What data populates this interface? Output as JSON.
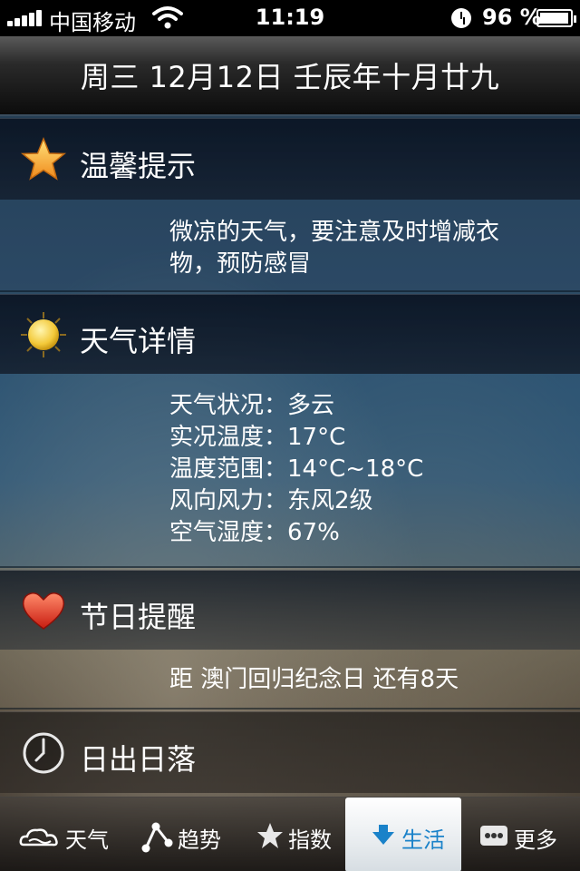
{
  "status": {
    "carrier": "中国移动",
    "time": "11:19",
    "battery": "96 %"
  },
  "header": {
    "date": "周三 12月12日 壬辰年十月廿九"
  },
  "sections": {
    "tips": {
      "icon": "star-icon",
      "title": "温馨提示",
      "lines": [
        "微凉的天气，要注意及时增减衣",
        "物，预防感冒"
      ]
    },
    "weather": {
      "icon": "sun-icon",
      "title": "天气详情",
      "lines": [
        "天气状况：多云",
        "实况温度：17°C",
        "温度范围：14°C~18°C",
        "风向风力：东风2级",
        "空气湿度：67%"
      ]
    },
    "festival": {
      "icon": "heart-icon",
      "title": "节日提醒",
      "line": "距 澳门回归纪念日 还有8天"
    },
    "sunrise": {
      "icon": "clock-icon",
      "title": "日出日落"
    }
  },
  "tabs": [
    {
      "label": "天气",
      "icon": "cloud-icon",
      "active": false
    },
    {
      "label": "趋势",
      "icon": "trend-icon",
      "active": false
    },
    {
      "label": "指数",
      "icon": "index-icon",
      "active": false
    },
    {
      "label": "生活",
      "icon": "life-icon",
      "active": true
    },
    {
      "label": "更多",
      "icon": "more-icon",
      "active": false
    }
  ],
  "colors": {
    "active_tab_text": "#1a82c9",
    "section_header_bg": "#0f1c2b"
  }
}
